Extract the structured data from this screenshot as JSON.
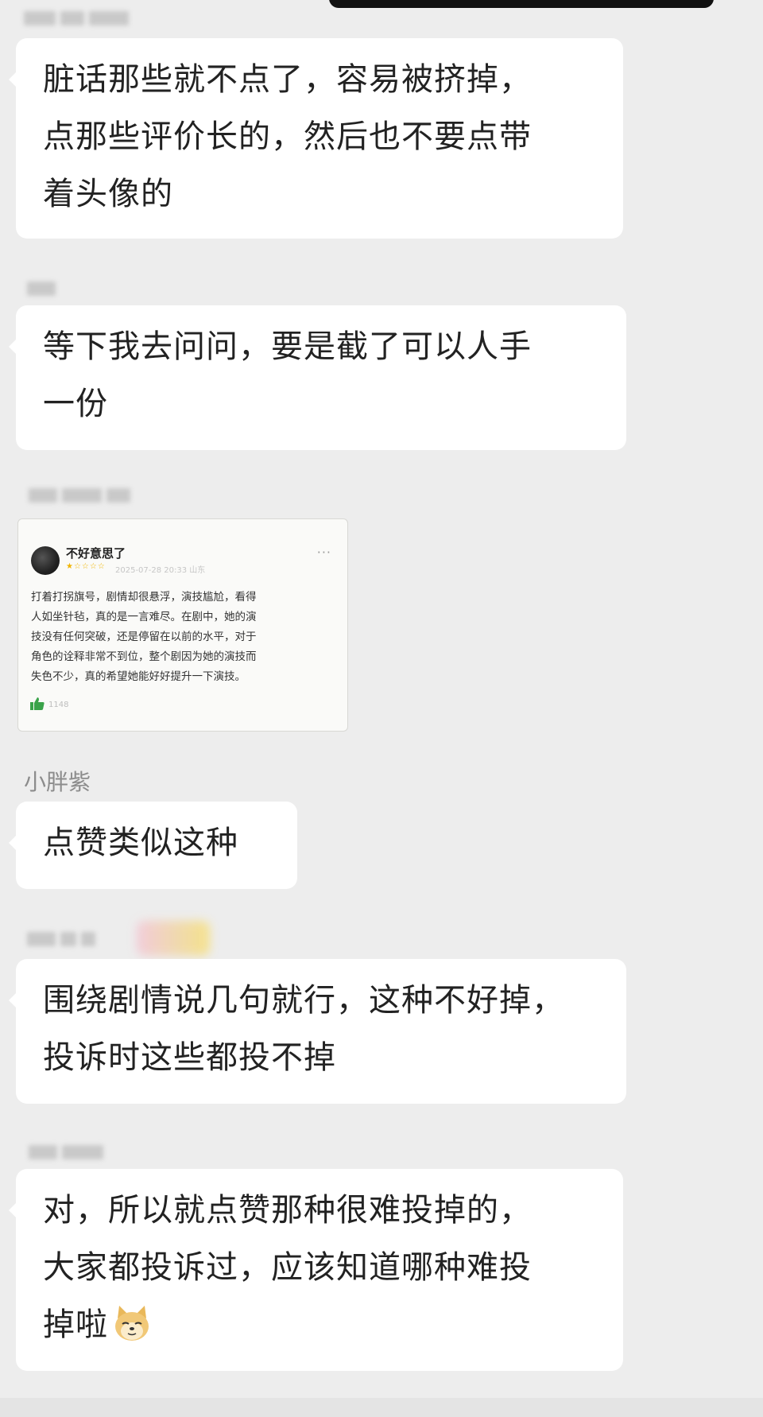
{
  "messages": [
    {
      "sender_blurred": true,
      "lines": [
        "脏话那些就不点了，容易被挤掉，",
        "点那些评价长的，然后也不要点带",
        "着头像的"
      ]
    },
    {
      "sender_blurred": true,
      "lines": [
        "等下我去问问，要是截了可以人手",
        "一份"
      ]
    },
    {
      "sender_blurred": true,
      "type": "image",
      "card": {
        "username": "不好意思了",
        "stars": "★☆☆☆☆",
        "meta": "2025-07-28 20:33 山东",
        "more": "···",
        "review_lines": [
          "打着打拐旗号，剧情却很悬浮，演技尴尬，看得",
          "人如坐针毡，真的是一言难尽。在剧中，她的演",
          "技没有任何突破，还是停留在以前的水平，对于",
          "角色的诠释非常不到位，整个剧因为她的演技而",
          "失色不少，真的希望她能好好提升一下演技。"
        ],
        "likes": "1148"
      }
    },
    {
      "sender": "小胖紫",
      "lines": [
        "点赞类似这种"
      ]
    },
    {
      "sender_blurred": true,
      "lines": [
        "围绕剧情说几句就行，这种不好掉，",
        "投诉时这些都投不掉"
      ]
    },
    {
      "sender_blurred": true,
      "lines": [
        "对，所以就点赞那种很难投掉的，",
        "大家都投诉过，应该知道哪种难投",
        "掉啦"
      ],
      "trailing_emoji": "doge-emoji"
    }
  ]
}
